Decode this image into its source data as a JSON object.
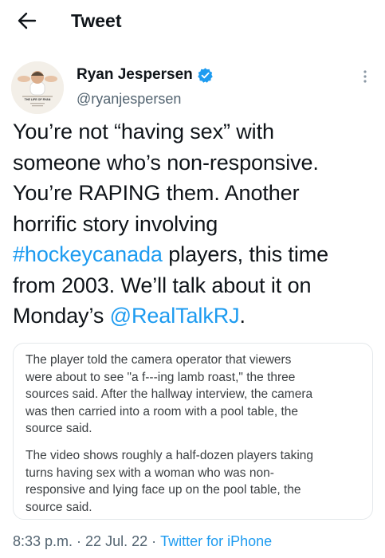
{
  "header": {
    "title": "Tweet"
  },
  "author": {
    "name": "Ryan Jespersen",
    "handle": "@ryanjespersen",
    "avatar_caption": "THE LIFE OF RYAN"
  },
  "tweet": {
    "lines": [
      [
        {
          "text": "You’re not “having sex” with"
        }
      ],
      [
        {
          "text": "someone who’s non-responsive."
        }
      ],
      [
        {
          "text": "You’re RAPING them. Another"
        }
      ],
      [
        {
          "text": "horrific story involving"
        }
      ],
      [
        {
          "text": "#hockeycanada",
          "link": true
        },
        {
          "text": " players, this time"
        }
      ],
      [
        {
          "text": "from 2003. We’ll talk about it on"
        }
      ],
      [
        {
          "text": "Monday’s "
        },
        {
          "text": "@RealTalkRJ",
          "link": true
        },
        {
          "text": "."
        }
      ]
    ]
  },
  "quote": {
    "paragraph1": [
      "The player told the camera operator that viewers",
      "were about to see \"a f---ing lamb roast,\" the three",
      "sources said. After the hallway interview, the camera",
      "was then carried into a room with a pool table, the",
      "source said."
    ],
    "paragraph2": [
      "The video shows roughly a half-dozen players taking",
      "turns having sex with a woman who was non-",
      "responsive and lying face up on the pool table, the",
      "source said."
    ]
  },
  "meta": {
    "time": "8:33 p.m.",
    "separator": "·",
    "date": "22 Jul. 22",
    "source": "Twitter for iPhone"
  },
  "colors": {
    "link": "#1d9bf0",
    "verified": "#1d9bf0",
    "secondary_text": "#536471"
  },
  "icons": {
    "back": "arrow-left-icon",
    "verified": "verified-badge-icon",
    "more": "more-vertical-icon"
  }
}
